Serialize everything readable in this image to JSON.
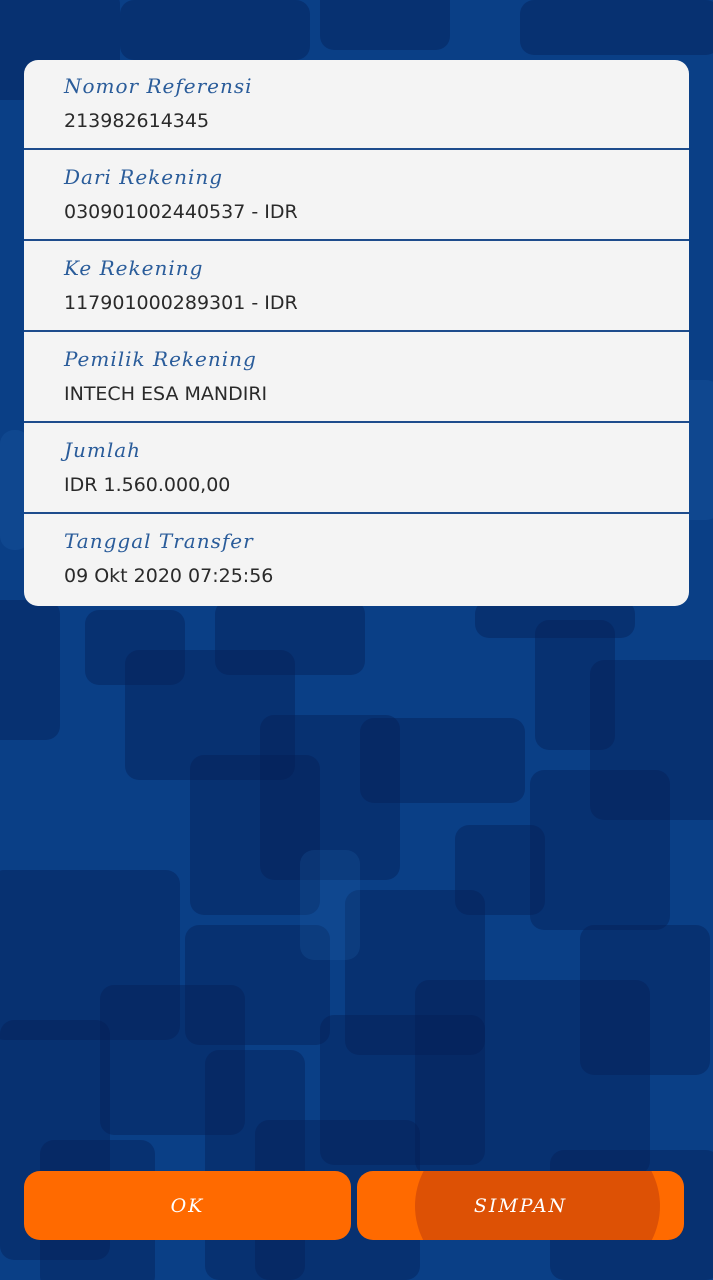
{
  "details": [
    {
      "label": "Nomor Referensi",
      "value": "213982614345"
    },
    {
      "label": "Dari Rekening",
      "value": "030901002440537 - IDR"
    },
    {
      "label": "Ke Rekening",
      "value": "117901000289301 - IDR"
    },
    {
      "label": "Pemilik Rekening",
      "value": "INTECH ESA MANDIRI"
    },
    {
      "label": "Jumlah",
      "value": "IDR 1.560.000,00"
    },
    {
      "label": "Tanggal Transfer",
      "value": "09 Okt 2020 07:25:56"
    }
  ],
  "buttons": {
    "ok": "OK",
    "save": "SIMPAN"
  },
  "colors": {
    "background": "#0a3f86",
    "card": "#f4f4f4",
    "label": "#2a5c9a",
    "button": "#ff6a00"
  }
}
